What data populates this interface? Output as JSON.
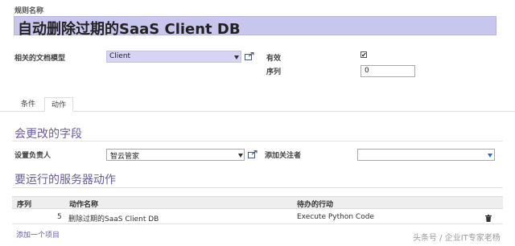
{
  "rule_name": {
    "label": "规则名称",
    "value": "自动删除过期的SaaS Client DB"
  },
  "form": {
    "model_label": "相关的文档模型",
    "model_value": "Client",
    "active_label": "有效",
    "active_checked": "✔",
    "sequence_label": "序列",
    "sequence_value": "0"
  },
  "tabs": [
    {
      "label": "条件"
    },
    {
      "label": "动作"
    }
  ],
  "fields_section": {
    "title": "会更改的字段",
    "responsible_label": "设置负责人",
    "responsible_value": "智云管家",
    "followers_label": "添加关注者",
    "followers_value": ""
  },
  "actions_section": {
    "title": "要运行的服务器动作",
    "columns": [
      "序列",
      "动作名称",
      "待办的行动"
    ],
    "rows": [
      {
        "sequence": "5",
        "name": "删除过期的SaaS Client DB",
        "action": "Execute Python Code"
      }
    ],
    "add_item_label": "添加一个项目"
  },
  "watermark": "头条号 / 企业IT专家老杨",
  "colors": {
    "title_bg": "#c9c6ee",
    "select_bg": "#d6d3f3",
    "section_title": "#6a5b9d",
    "link": "#6a5b9d",
    "dropdown_caret_blue": "#2a6ebd"
  },
  "icons": [
    "external-link-icon",
    "dropdown-caret-icon",
    "checkbox-icon",
    "trash-icon"
  ]
}
